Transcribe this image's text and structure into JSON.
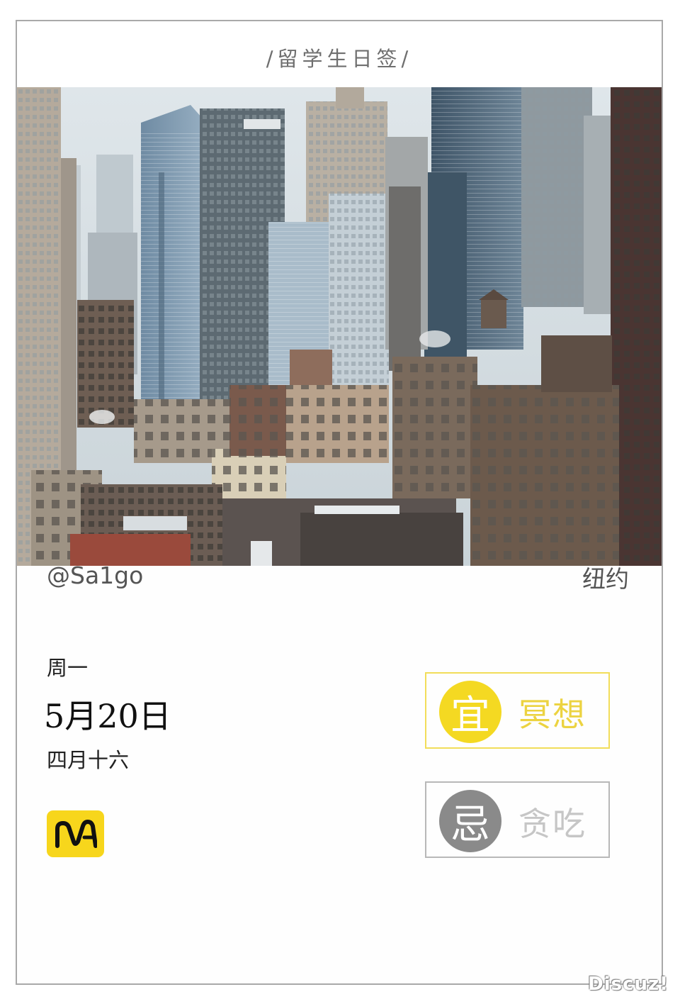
{
  "header": {
    "title": "/留学生日签/"
  },
  "photo": {
    "description_icon": "city-skyline-photo"
  },
  "info": {
    "author": "@Sa1go",
    "city": "纽约",
    "weekday": "周一",
    "date": "5月20日",
    "lunar": "四月十六"
  },
  "logo": {
    "text": "MA",
    "color": "#f7d61c"
  },
  "fortune": {
    "good": {
      "label": "宜",
      "text": "冥想",
      "color": "#f4d922"
    },
    "bad": {
      "label": "忌",
      "text": "贪吃",
      "color": "#8a8a8a"
    }
  },
  "watermark": {
    "text": "Discuz!"
  }
}
